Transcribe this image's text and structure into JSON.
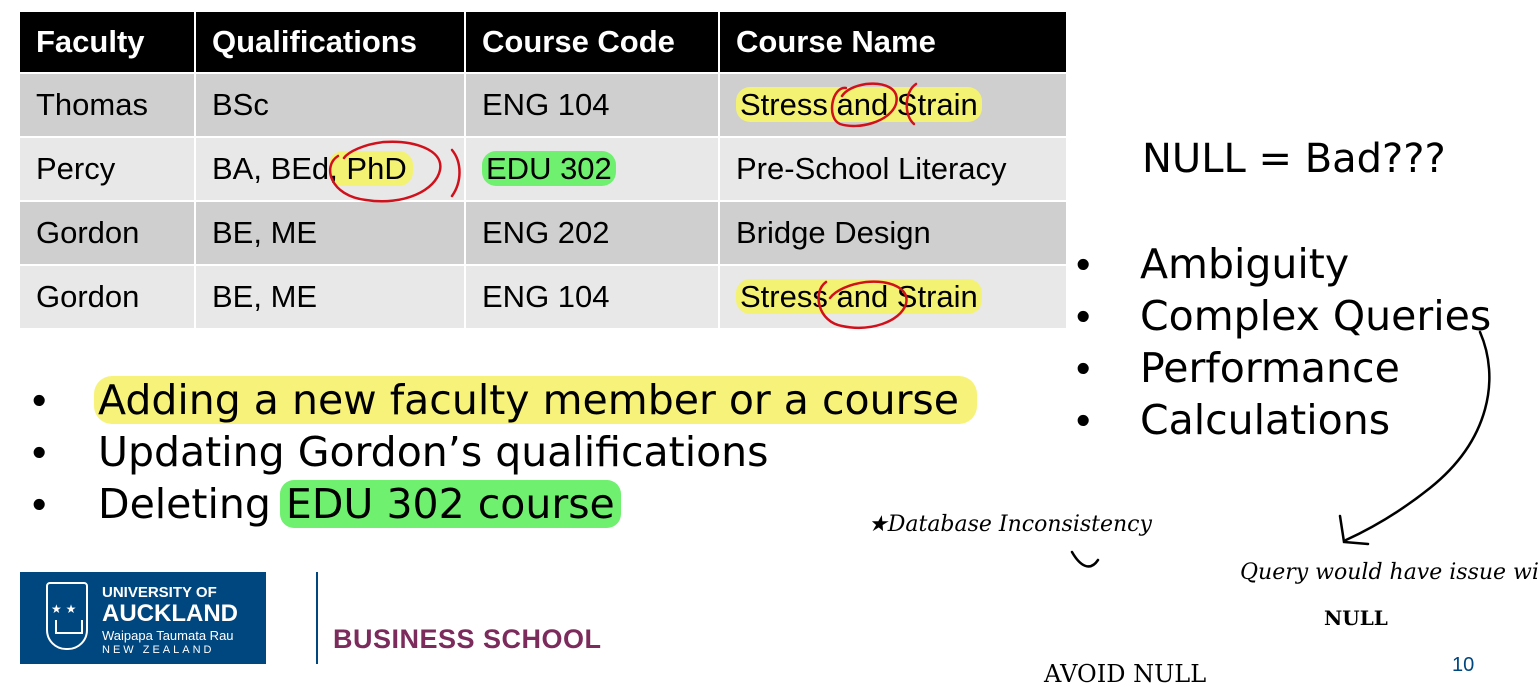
{
  "table": {
    "headers": [
      "Faculty",
      "Qualifications",
      "Course Code",
      "Course Name"
    ],
    "rows": [
      [
        "Thomas",
        "BSc",
        "ENG 104",
        "Stress and Strain"
      ],
      [
        "Percy",
        "BA, BEd, PhD",
        "EDU 302",
        "Pre-School Literacy"
      ],
      [
        "Gordon",
        "BE, ME",
        "ENG 202",
        "Bridge Design"
      ],
      [
        "Gordon",
        "BE, ME",
        "ENG 104",
        "Stress and Strain"
      ]
    ],
    "percy_qual_plain": "BA, BEd",
    "percy_qual_highlight": ", PhD"
  },
  "left_bullets": [
    "Adding a new faculty member or a course",
    "Updating Gordon’s qualifications"
  ],
  "delete_bullet": {
    "prefix": "Deleting ",
    "highlight": "EDU 302 course"
  },
  "null_title": "NULL = Bad???",
  "right_bullets": [
    "Ambiguity",
    "Complex Queries",
    "Performance",
    "Calculations"
  ],
  "handwritten": {
    "db_inconsistency": "★Database Inconsistency",
    "query_issue": "Query would have issue with",
    "null_word": "NULL",
    "avoid_null": "AVOID NULL"
  },
  "footer": {
    "logo_line1": "UNIVERSITY OF",
    "logo_line2": "AUCKLAND",
    "logo_line3": "Waipapa Taumata Rau",
    "logo_line4": "NEW ZEALAND",
    "school": "BUSINESS SCHOOL",
    "page_number": "10"
  },
  "colors": {
    "highlight_yellow": "#f4f273",
    "highlight_green": "#6ff06f",
    "table_header": "#000000",
    "row_dark": "#cfcfcf",
    "row_light": "#e8e8e8",
    "annotation_red": "#d0101a",
    "logo_blue": "#00467f",
    "school_text": "#7c2c5c"
  }
}
